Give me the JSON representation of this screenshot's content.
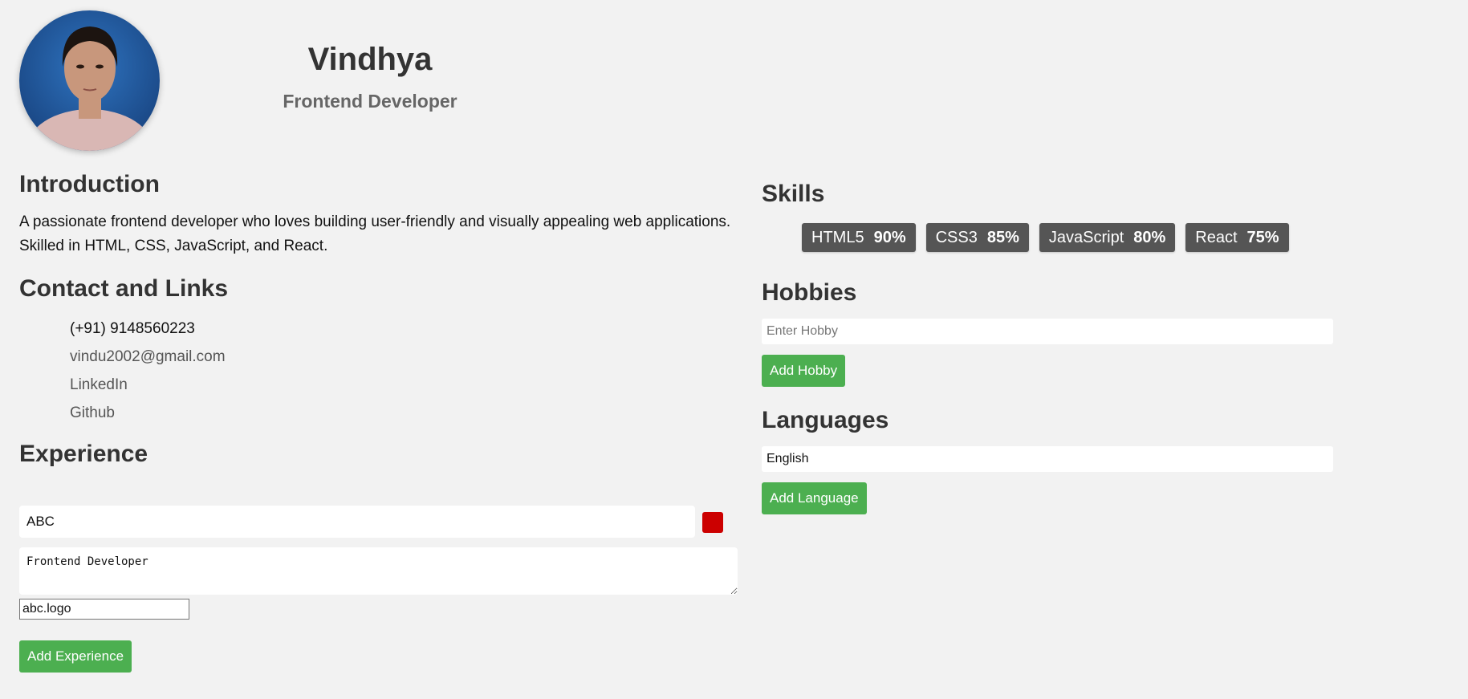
{
  "profile": {
    "name": "Vindhya",
    "role": "Frontend Developer"
  },
  "introduction": {
    "heading": "Introduction",
    "text": "A passionate frontend developer who loves building user-friendly and visually appealing web applications. Skilled in HTML, CSS, JavaScript, and React."
  },
  "contact": {
    "heading": "Contact and Links",
    "phone": "(+91) 9148560223",
    "email": "vindu2002@gmail.com",
    "linkedin": "LinkedIn",
    "github": "Github"
  },
  "experience": {
    "heading": "Experience",
    "company_value": "ABC",
    "role_value": "Frontend Developer",
    "logo_value": "abc.logo",
    "add_button": "Add Experience"
  },
  "skills": {
    "heading": "Skills",
    "items": [
      {
        "name": "HTML5",
        "percent": "90%"
      },
      {
        "name": "CSS3",
        "percent": "85%"
      },
      {
        "name": "JavaScript",
        "percent": "80%"
      },
      {
        "name": "React",
        "percent": "75%"
      }
    ]
  },
  "hobbies": {
    "heading": "Hobbies",
    "placeholder": "Enter Hobby",
    "add_button": "Add Hobby"
  },
  "languages": {
    "heading": "Languages",
    "value": "English",
    "add_button": "Add Language"
  },
  "colors": {
    "background": "#f2f2f2",
    "accent_green": "#4caf50",
    "skill_badge": "#555555",
    "delete_red": "#cc0000"
  }
}
